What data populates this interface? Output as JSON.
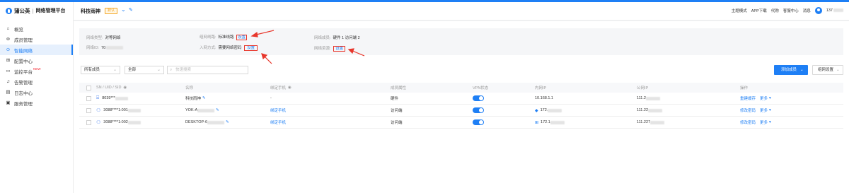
{
  "brand": {
    "name": "蒲公英",
    "sub": "网络管理平台"
  },
  "sidebar": {
    "items": [
      {
        "label": "概览",
        "icon": "⌂",
        "icon_name": "home-icon",
        "active": false
      },
      {
        "label": "成员管理",
        "icon": "⊚",
        "icon_name": "layers-icon",
        "active": false
      },
      {
        "label": "智能网络",
        "icon": "⊙",
        "icon_name": "network-icon",
        "active": true
      },
      {
        "label": "配置中心",
        "icon": "⊞",
        "icon_name": "grid-icon",
        "active": false
      },
      {
        "label": "监控平台",
        "icon": "▭",
        "icon_name": "monitor-icon",
        "active": false,
        "badge": "NEW"
      },
      {
        "label": "告警管理",
        "icon": "♫",
        "icon_name": "bell-icon",
        "active": false
      },
      {
        "label": "日志中心",
        "icon": "▤",
        "icon_name": "log-icon",
        "active": false
      },
      {
        "label": "服务管理",
        "icon": "▣",
        "icon_name": "service-icon",
        "active": false
      }
    ]
  },
  "header": {
    "title": "科技雨神",
    "tag": "默认",
    "right": {
      "theme": "主题模式",
      "app": "APP下载",
      "agent": "代购",
      "help": "客服中心",
      "msg": "消息",
      "user": "137"
    }
  },
  "info": {
    "net_type_label": "网络类型:",
    "net_type_value": "对等网络",
    "net_id_label": "网络ID:",
    "net_id_value": "70",
    "line_label": "组网线路:",
    "line_value": "标准线路",
    "line_link": "设置",
    "access_label": "入网方式:",
    "access_value": "需要网络密码",
    "access_link": "设置",
    "members_label": "网络成员:",
    "members_value": "硬件 1  访问端 2",
    "resource_label": "网络资源:",
    "resource_link": "设置"
  },
  "filters": {
    "member_select": "所有成员",
    "scope_select": "全部",
    "search_placeholder": "快速搜索",
    "add_button": "添加成员",
    "settings_button": "组网设置"
  },
  "table": {
    "headers": [
      "SN / UID / SID",
      "名称",
      "绑定手机",
      "成员属性",
      "VPN状态",
      "内网IP",
      "公网IP",
      "操作"
    ],
    "rows": [
      {
        "id": "8039***",
        "name": "科技雨神",
        "phone": "-",
        "attr": "硬件",
        "lan_ip": "10.168.1.1",
        "wan_ip": "111.2",
        "action": "重建缓存",
        "more": "更多",
        "type": "router"
      },
      {
        "id": "3088****1:001",
        "name": "YOK-A",
        "phone": "绑定手机",
        "attr": "访问端",
        "lan_ip": "172.",
        "wan_ip": "111.22",
        "action": "修改密码",
        "more": "更多",
        "type": "mac"
      },
      {
        "id": "3088****1:002",
        "name": "DESKTOP-6",
        "phone": "绑定手机",
        "attr": "访问端",
        "lan_ip": "172.1",
        "wan_ip": "111.227",
        "action": "修改密码",
        "more": "更多",
        "type": "windows"
      }
    ]
  },
  "colors": {
    "accent": "#1e7ff5",
    "annotation": "#e8372c",
    "tag": "#f5a623"
  }
}
